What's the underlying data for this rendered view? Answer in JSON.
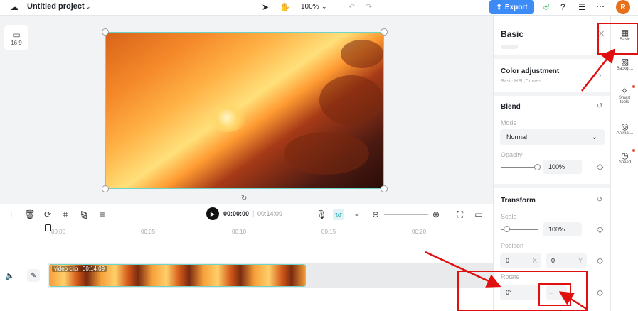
{
  "header": {
    "project_title": "Untitled project",
    "zoom": "100%",
    "export_label": "Export",
    "avatar_initial": "R"
  },
  "canvas": {
    "ratio_label": "16:9"
  },
  "playback": {
    "current_time": "00:00:00",
    "total_time": "00:14:09"
  },
  "timeline": {
    "ruler": [
      "00:00",
      "00:05",
      "00:10",
      "00:15",
      "00:20"
    ],
    "clip_label": "video clip",
    "clip_duration": "00:14:09"
  },
  "panel": {
    "title": "Basic",
    "color_adjustment": {
      "title": "Color adjustment",
      "subtitle": "Basic,HSL,Curves"
    },
    "blend": {
      "title": "Blend",
      "mode_label": "Mode",
      "mode_value": "Normal",
      "opacity_label": "Opacity",
      "opacity_value": "100%",
      "opacity_level": 1.0
    },
    "transform": {
      "title": "Transform",
      "scale_label": "Scale",
      "scale_value": "100%",
      "position_label": "Position",
      "position_x": "0",
      "position_x_axis": "X",
      "position_y": "0",
      "position_y_axis": "Y",
      "rotate_label": "Rotate",
      "rotate_value": "0°",
      "rotate_button": "-- ·"
    }
  },
  "sidebar": {
    "items": [
      {
        "label": "Basic",
        "icon": "film-icon"
      },
      {
        "label": "Backgr...",
        "icon": "background-icon"
      },
      {
        "label": "Smart tools",
        "icon": "magic-wand-icon"
      },
      {
        "label": "Animat...",
        "icon": "animation-icon"
      },
      {
        "label": "Speed",
        "icon": "speed-icon"
      }
    ]
  },
  "colors": {
    "accent": "#3d8bf7",
    "selection": "#6fd3c9",
    "annotation": "#e01010",
    "avatar": "#e8701a"
  }
}
